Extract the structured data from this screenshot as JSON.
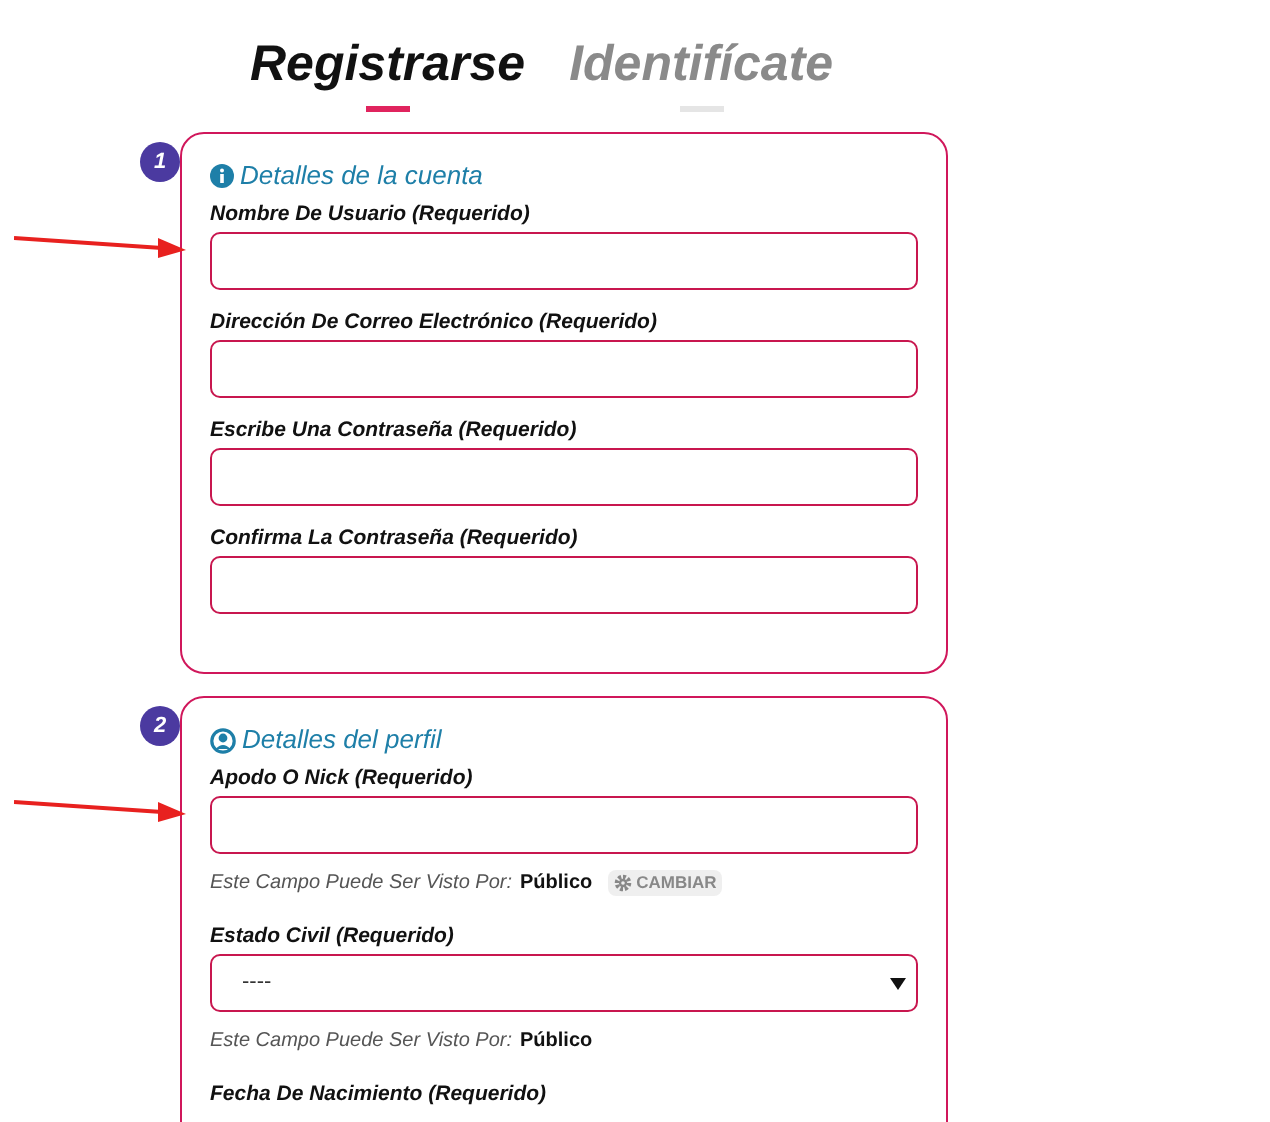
{
  "tabs": [
    {
      "label": "Registrarse",
      "selected": true
    },
    {
      "label": "Identifícate",
      "selected": false
    }
  ],
  "sections": [
    {
      "number": "1",
      "title": "Detalles de la cuenta",
      "fields": [
        {
          "kind": "input",
          "label": "Nombre De Usuario (Requerido)",
          "arrow": true
        },
        {
          "kind": "input",
          "label": "Dirección De Correo Electrónico (Requerido)",
          "arrow": false
        },
        {
          "kind": "input",
          "label": "Escribe Una Contraseña (Requerido)",
          "arrow": false
        },
        {
          "kind": "input",
          "label": "Confirma La Contraseña (Requerido)",
          "arrow": false
        }
      ]
    },
    {
      "number": "2",
      "title": "Detalles del perfil",
      "fields": [
        {
          "kind": "input",
          "label": "Apodo O Nick (Requerido)",
          "arrow": true,
          "visibility_label": "Este Campo Puede Ser Visto Por:",
          "visibility_value": "Público",
          "change_button": "CAMBIAR"
        },
        {
          "kind": "select",
          "label": "Estado Civil (Requerido)",
          "arrow": false,
          "value": "----",
          "visibility_label": "Este Campo Puede Ser Visto Por:",
          "visibility_value": "Público"
        },
        {
          "kind": "label",
          "label": "Fecha De Nacimiento (Requerido)"
        }
      ]
    }
  ]
}
